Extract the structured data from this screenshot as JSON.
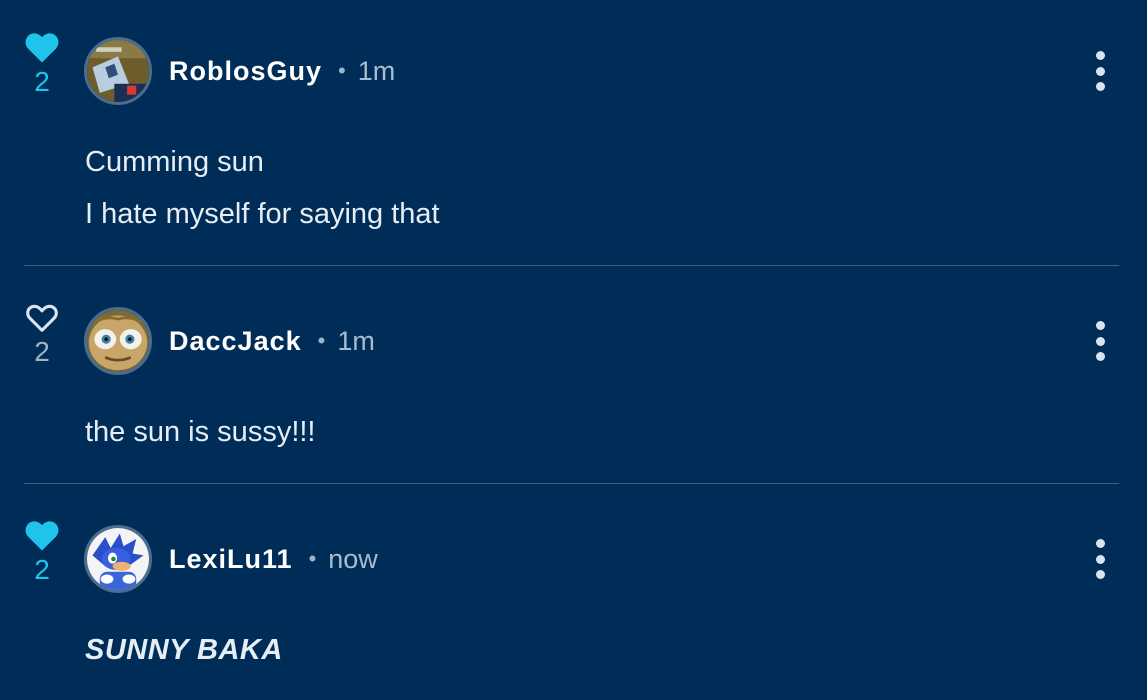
{
  "colors": {
    "background": "#002d57",
    "liked_heart": "#1fc3ec",
    "unliked_heart": "#dbe4ee",
    "divider": "#3e607f"
  },
  "comments": [
    {
      "username": "RoblosGuy",
      "separator": "•",
      "time": "1m",
      "likes": "2",
      "liked": true,
      "heart_icon": "heart-filled-icon",
      "avatar_icon": "avatar-image",
      "menu_icon": "kebab-menu-icon",
      "lines": [
        "Cumming sun",
        "I hate myself for saying that"
      ]
    },
    {
      "username": "DaccJack",
      "separator": "•",
      "time": "1m",
      "likes": "2",
      "liked": false,
      "heart_icon": "heart-outline-icon",
      "avatar_icon": "avatar-image",
      "menu_icon": "kebab-menu-icon",
      "lines": [
        "the sun is sussy!!!"
      ]
    },
    {
      "username": "LexiLu11",
      "separator": "•",
      "time": "now",
      "likes": "2",
      "liked": true,
      "heart_icon": "heart-filled-icon",
      "avatar_icon": "avatar-image",
      "menu_icon": "kebab-menu-icon",
      "lines": [
        "SUNNY BAKA"
      ]
    }
  ]
}
